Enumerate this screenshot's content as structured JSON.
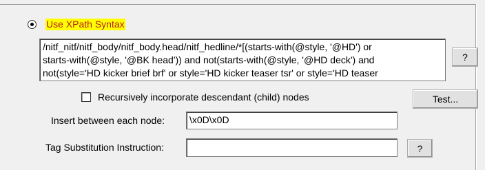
{
  "xpath_option": {
    "label": "Use XPath Syntax",
    "selected": true,
    "expression_lines": [
      "/nitf_nitf/nitf_body/nitf_body.head/nitf_hedline/*[(starts-with(@style, '@HD') or",
      "starts-with(@style, '@BK head')) and not(starts-with(@style, '@HD deck') and",
      "not(style='HD kicker brief brf' or style='HD kicker teaser tsr' or style='HD teaser"
    ]
  },
  "help_button_1": {
    "label": "?"
  },
  "recursive_option": {
    "label": "Recursively incorporate descendant (child) nodes",
    "checked": false
  },
  "test_button": {
    "label": "Test..."
  },
  "insert_between": {
    "label": "Insert between each node:",
    "value": "\\x0D\\x0D"
  },
  "tag_substitution": {
    "label": "Tag Substitution Instruction:",
    "value": ""
  },
  "help_button_2": {
    "label": "?"
  },
  "colors": {
    "highlight_bg": "#ffff00",
    "highlight_text": "#b41e1e",
    "dialog_bg": "#f0f0f0"
  }
}
